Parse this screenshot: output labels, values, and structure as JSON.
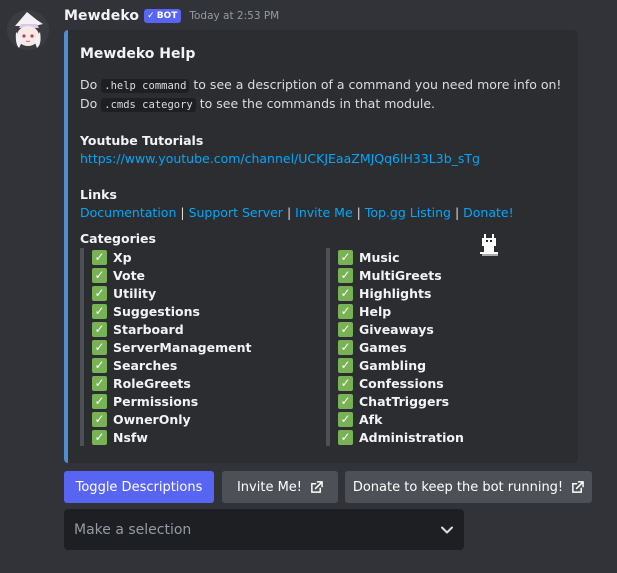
{
  "message": {
    "username": "Mewdeko",
    "badge": "BOT",
    "timestamp": "Today at 2:53 PM"
  },
  "embed": {
    "accent_color": "#4f8fd0",
    "title": "Mewdeko Help",
    "desc_line1_pre": "Do ",
    "desc_line1_code": ".help command",
    "desc_line1_post": " to see a description of a command you need more info on!",
    "desc_line2_pre": "Do ",
    "desc_line2_code": ".cmds category",
    "desc_line2_post": " to see the commands in that module.",
    "youtube_heading": "Youtube Tutorials",
    "youtube_link": "https://www.youtube.com/channel/UCKJEaaZMJQq6lH33L3b_sTg",
    "links_heading": "Links",
    "links": [
      "Documentation",
      "Support Server",
      "Invite Me",
      "Top.gg Listing",
      "Donate!"
    ],
    "separator": "|",
    "categories_heading": "Categories",
    "categories_left": [
      "Xp",
      "Vote",
      "Utility",
      "Suggestions",
      "Starboard",
      "ServerManagement",
      "Searches",
      "RoleGreets",
      "Permissions",
      "OwnerOnly",
      "Nsfw"
    ],
    "categories_right": [
      "Music",
      "MultiGreets",
      "Highlights",
      "Help",
      "Giveaways",
      "Games",
      "Gambling",
      "Confessions",
      "ChatTriggers",
      "Afk",
      "Administration"
    ]
  },
  "buttons": {
    "toggle": "Toggle Descriptions",
    "invite": "Invite Me!",
    "donate": "Donate to keep the bot running!"
  },
  "select": {
    "placeholder": "Make a selection"
  },
  "icons": {
    "close": "close-icon",
    "check": "white-check-mark-icon",
    "external": "external-link-icon",
    "chevron": "chevron-down-icon"
  },
  "colors": {
    "primary": "#5865f2",
    "secondary": "#4e5058",
    "link": "#00a8fc",
    "check": "#77b255"
  }
}
